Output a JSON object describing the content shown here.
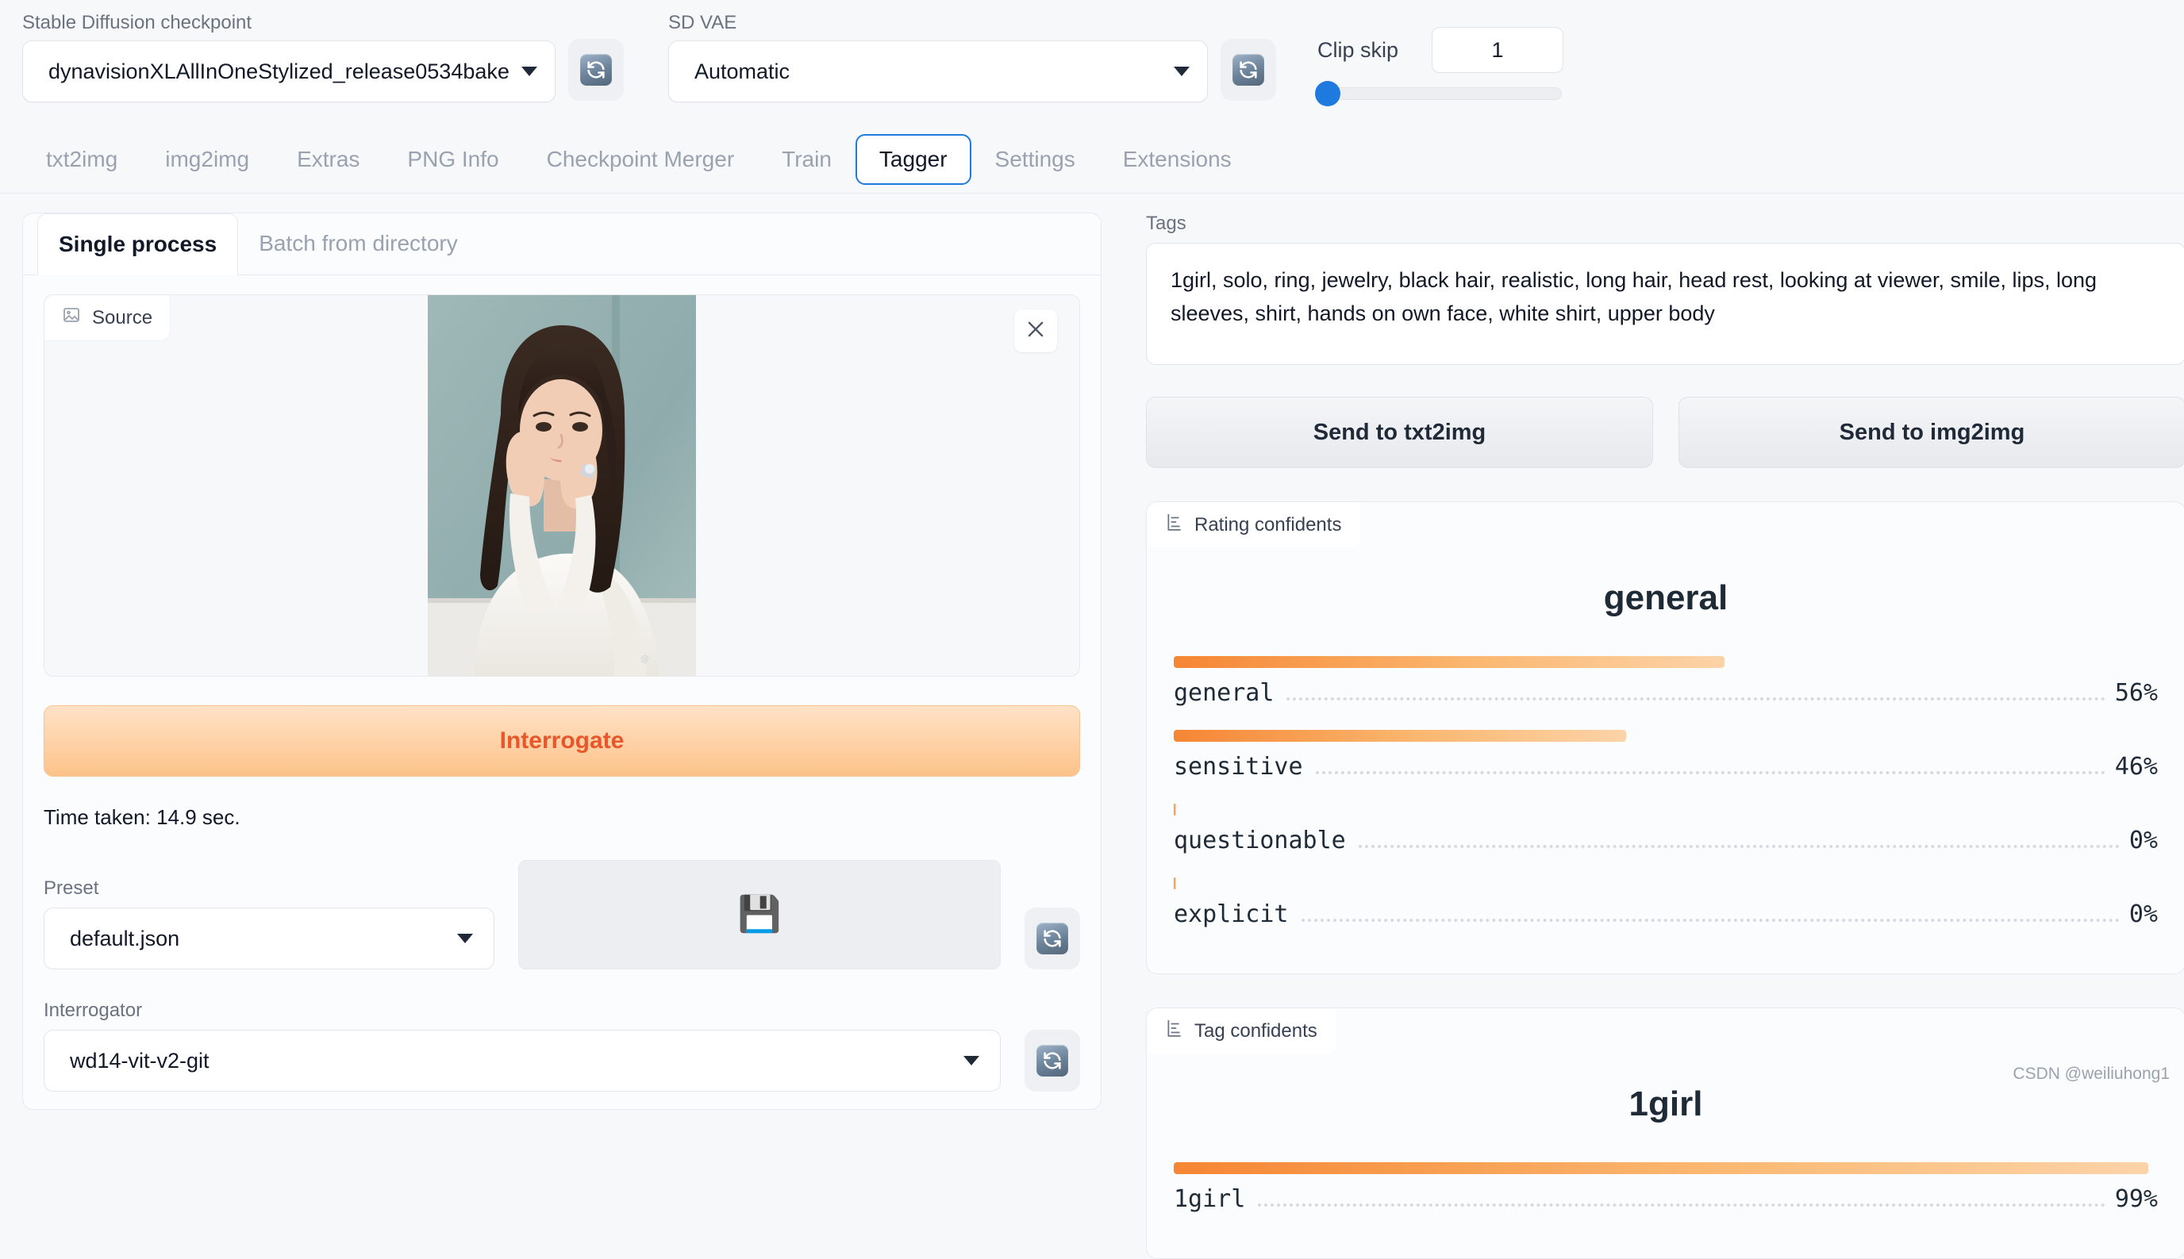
{
  "topbar": {
    "checkpoint_label": "Stable Diffusion checkpoint",
    "checkpoint_value": "dynavisionXLAllInOneStylized_release0534bake",
    "vae_label": "SD VAE",
    "vae_value": "Automatic",
    "clip_skip_label": "Clip skip",
    "clip_skip_value": "1",
    "refresh_icon": "refresh-icon"
  },
  "tabs": [
    {
      "label": "txt2img",
      "active": false
    },
    {
      "label": "img2img",
      "active": false
    },
    {
      "label": "Extras",
      "active": false
    },
    {
      "label": "PNG Info",
      "active": false
    },
    {
      "label": "Checkpoint Merger",
      "active": false
    },
    {
      "label": "Train",
      "active": false
    },
    {
      "label": "Tagger",
      "active": true
    },
    {
      "label": "Settings",
      "active": false
    },
    {
      "label": "Extensions",
      "active": false
    }
  ],
  "left": {
    "subtabs": [
      {
        "label": "Single process",
        "active": true
      },
      {
        "label": "Batch from directory",
        "active": false
      }
    ],
    "source_chip_label": "Source",
    "source_chip_icon": "image-icon",
    "close_icon": "close-icon",
    "interrogate_label": "Interrogate",
    "time_taken": "Time taken: 14.9 sec.",
    "preset_label": "Preset",
    "preset_value": "default.json",
    "save_icon": "floppy-disk-icon",
    "interrogator_label": "Interrogator",
    "interrogator_value": "wd14-vit-v2-git"
  },
  "right": {
    "tags_label": "Tags",
    "tags_value": "1girl, solo, ring, jewelry, black hair, realistic, long hair, head rest, looking at viewer, smile, lips, long sleeves, shirt, hands on own face, white shirt, upper body",
    "send_txt2img": "Send to txt2img",
    "send_img2img": "Send to img2img",
    "rating_panel_label": "Rating confidents",
    "tag_panel_label": "Tag confidents",
    "panel_icon": "bar-chart-icon"
  },
  "watermark": "CSDN @weiliuhong1",
  "colors": {
    "accent_orange": "#f58634",
    "accent_orange_light": "#fcd3a8",
    "interrogate_text": "#e8562a",
    "tab_active_border": "#1f7ae0",
    "slider_thumb": "#1f7ae0"
  },
  "chart_data": [
    {
      "type": "bar",
      "title": "general",
      "panel": "Rating confidents",
      "orientation": "horizontal",
      "xlim": [
        0,
        100
      ],
      "grid": false,
      "categories": [
        "general",
        "sensitive",
        "questionable",
        "explicit"
      ],
      "values": [
        56,
        46,
        0,
        0
      ],
      "labels": [
        "56%",
        "46%",
        "0%",
        "0%"
      ],
      "xlabel": "",
      "ylabel": ""
    },
    {
      "type": "bar",
      "title": "1girl",
      "panel": "Tag confidents",
      "orientation": "horizontal",
      "xlim": [
        0,
        100
      ],
      "grid": false,
      "categories": [
        "1girl"
      ],
      "values": [
        99
      ],
      "labels": [
        "99%"
      ],
      "xlabel": "",
      "ylabel": ""
    }
  ]
}
